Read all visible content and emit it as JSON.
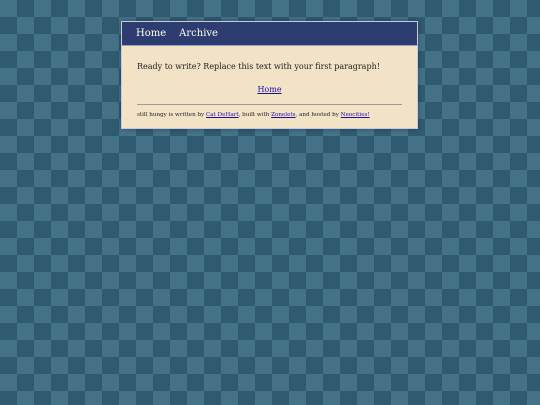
{
  "nav": {
    "items": [
      {
        "label": "Home"
      },
      {
        "label": "Archive"
      }
    ]
  },
  "main": {
    "paragraph": "Ready to write? Replace this text with your first paragraph!",
    "home_link": "Home"
  },
  "footer": {
    "text_1": "still hungy is written by ",
    "author": "Cat DeHart",
    "text_2": ", built with ",
    "builder": "Zonelets",
    "text_3": ", and hosted by ",
    "host": "Neocities!"
  },
  "colors": {
    "nav_bg": "#2e3d6f",
    "content_bg": "#f2e2c6",
    "link": "#1a0dab",
    "page_bg": "#3d6a80"
  }
}
